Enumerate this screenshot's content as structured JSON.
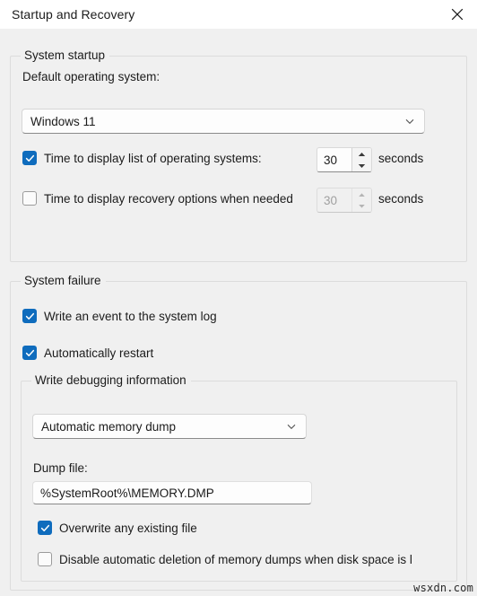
{
  "window": {
    "title": "Startup and Recovery",
    "close_icon": "close-icon"
  },
  "system_startup": {
    "group_label": "System startup",
    "default_os_label": "Default operating system:",
    "default_os_value": "Windows 11",
    "default_os_arrow_icon": "chevron-down-icon",
    "timeout_os": {
      "label": "Time to display list of operating systems:",
      "checked": true,
      "value": "30",
      "unit": "seconds",
      "up_icon": "chevron-up-icon",
      "down_icon": "chevron-down-icon"
    },
    "timeout_recovery": {
      "label": "Time to display recovery options when needed",
      "checked": false,
      "value": "30",
      "unit": "seconds",
      "up_icon": "chevron-up-icon",
      "down_icon": "chevron-down-icon"
    }
  },
  "system_failure": {
    "group_label": "System failure",
    "write_event": {
      "label": "Write an event to the system log",
      "checked": true
    },
    "auto_restart": {
      "label": "Automatically restart",
      "checked": true
    },
    "write_debugging": {
      "group_label": "Write debugging information",
      "dump_type_value": "Automatic memory dump",
      "dump_type_arrow_icon": "chevron-down-icon",
      "dump_file_label": "Dump file:",
      "dump_file_value": "%SystemRoot%\\MEMORY.DMP",
      "overwrite": {
        "label": "Overwrite any existing file",
        "checked": true
      },
      "disable_deletion": {
        "label": "Disable automatic deletion of memory dumps when disk space is l",
        "checked": false
      }
    }
  },
  "watermark": "wsxdn.com",
  "colors": {
    "accent": "#0f6cbd",
    "window_bg": "#f0f0f0",
    "titlebar_bg": "#ffffff",
    "text": "#1b1b1b",
    "border": "#dcdcdc"
  }
}
